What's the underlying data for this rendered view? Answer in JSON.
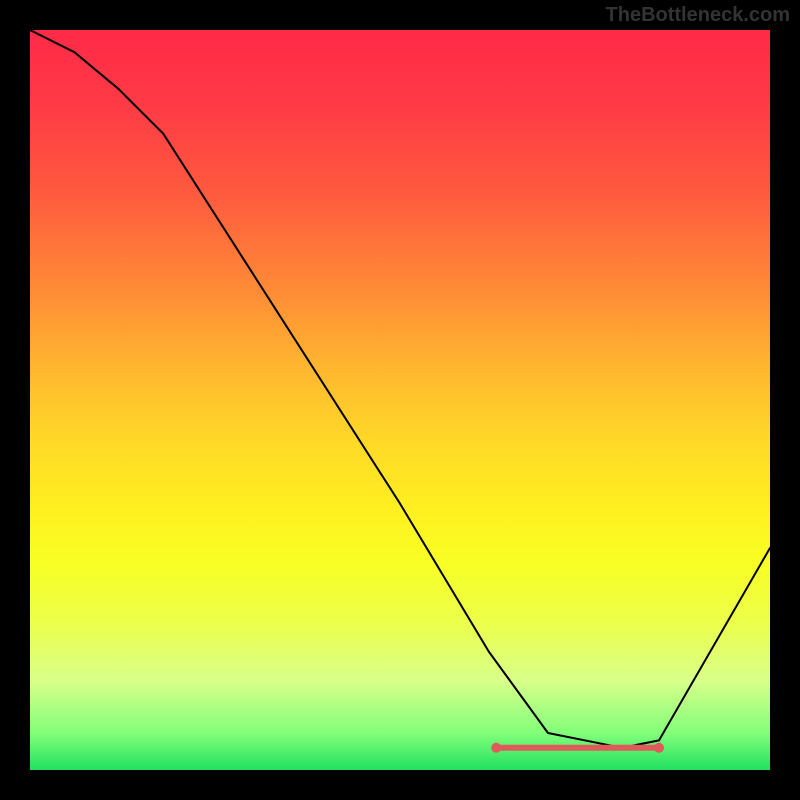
{
  "header": {
    "attribution": "TheBottleneck.com"
  },
  "chart_data": {
    "type": "line",
    "title": "",
    "xlabel": "",
    "ylabel": "",
    "xlim": [
      0,
      100
    ],
    "ylim": [
      0,
      100
    ],
    "x": [
      0,
      6,
      12,
      18,
      50,
      62,
      70,
      80,
      85,
      100
    ],
    "values": [
      100,
      97,
      92,
      86,
      36,
      16,
      5,
      3,
      4,
      30
    ],
    "flat_region": {
      "x_start": 63,
      "x_end": 85,
      "y": 3
    },
    "colors": {
      "curve": "#000000",
      "flat_line": "#e05a5a",
      "gradient_top": "#ff2a47",
      "gradient_bottom": "#20e060"
    }
  }
}
